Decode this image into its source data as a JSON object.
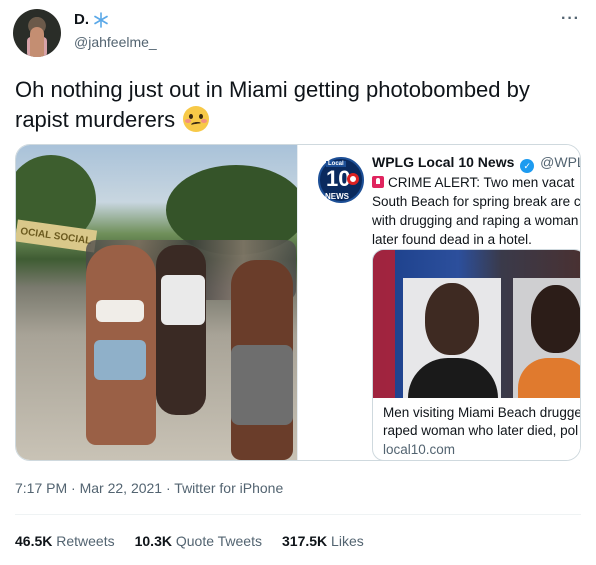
{
  "author": {
    "display_name": "D.",
    "handle": "@jahfeelme_",
    "badge_icon": "snowflake-icon"
  },
  "tweet": {
    "text": "Oh nothing just out in Miami getting photobombed by rapist murderers",
    "emoji": "woozy-face-emoji"
  },
  "embedded": {
    "logo_top": "Local",
    "logo_number": "10",
    "logo_bottom": "NEWS",
    "account_name": "WPLG Local 10 News",
    "account_handle": "@WPLGL",
    "lines": [
      "CRIME ALERT: Two men vacat",
      "South Beach for spring break are c",
      "with drugging and raping a woman",
      "later found dead in a hotel."
    ],
    "card": {
      "title_line1": "Men visiting Miami Beach drugge",
      "title_line2": "raped woman who later died, pol",
      "domain": "local10.com"
    }
  },
  "photo": {
    "banner_text": "OCIAL SOCIAL"
  },
  "meta": {
    "time": "7:17 PM",
    "separator": "·",
    "date": "Mar 22, 2021",
    "source": "Twitter for iPhone"
  },
  "stats": {
    "retweets_count": "46.5K",
    "retweets_label": "Retweets",
    "quotes_count": "10.3K",
    "quotes_label": "Quote Tweets",
    "likes_count": "317.5K",
    "likes_label": "Likes"
  },
  "colors": {
    "text": "#0f1419",
    "secondary": "#536471",
    "border": "#cfd9de",
    "verified": "#1d9bf0"
  }
}
